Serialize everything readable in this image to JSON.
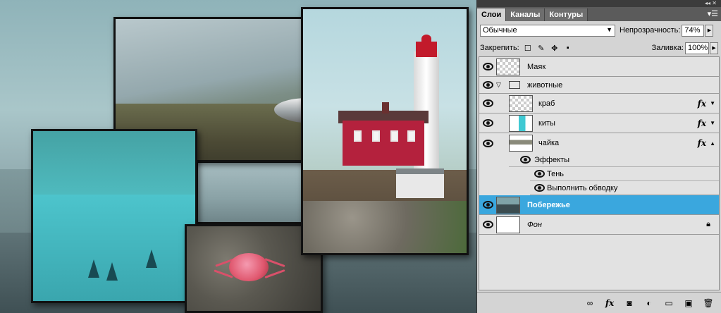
{
  "panel": {
    "tabs": [
      "Слои",
      "Каналы",
      "Контуры"
    ],
    "blend_mode": "Обычные",
    "opacity_label": "Непрозрачность:",
    "opacity_value": "74%",
    "lock_label": "Закрепить:",
    "fill_label": "Заливка:",
    "fill_value": "100%"
  },
  "layers": {
    "mayak": "Маяк",
    "group_animals": "животные",
    "crab": "краб",
    "whales": "киты",
    "gull": "чайка",
    "effects": "Эффекты",
    "shadow": "Тень",
    "stroke": "Выполнить обводку",
    "coast": "Побережье",
    "background": "Фон",
    "fx_symbol": "fx"
  },
  "icons": {
    "eye": "eye-icon",
    "folder": "folder-icon",
    "lock": "lock-icon",
    "link": "link-icon",
    "mask": "mask-icon",
    "adjust": "adjustment-icon",
    "new_group": "folder-icon",
    "new_layer": "new-layer-icon",
    "trash": "trash-icon"
  },
  "colors": {
    "selected_layer": "#3aa7de",
    "panel_bg": "#d4d4d4"
  }
}
